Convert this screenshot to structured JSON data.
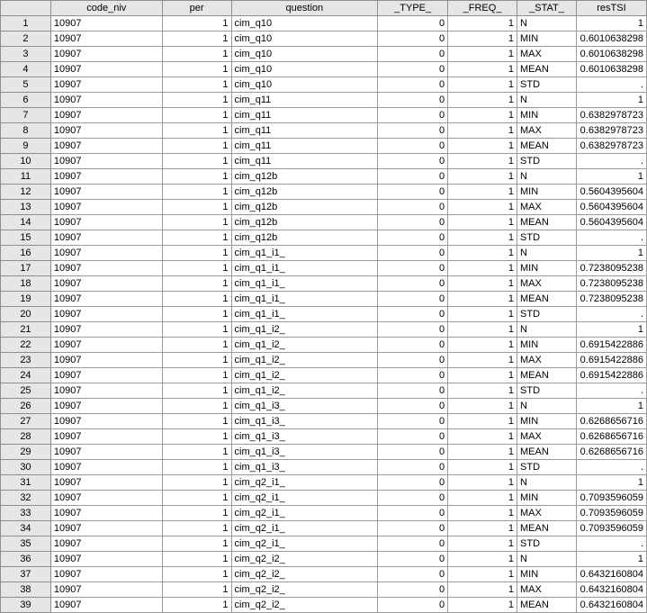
{
  "columns": [
    "code_niv",
    "per",
    "question",
    "_TYPE_",
    "_FREQ_",
    "_STAT_",
    "resTSI"
  ],
  "rows": [
    [
      "1",
      "10907",
      "1",
      "cim_q10",
      "0",
      "1",
      "N",
      "1"
    ],
    [
      "2",
      "10907",
      "1",
      "cim_q10",
      "0",
      "1",
      "MIN",
      "0.6010638298"
    ],
    [
      "3",
      "10907",
      "1",
      "cim_q10",
      "0",
      "1",
      "MAX",
      "0.6010638298"
    ],
    [
      "4",
      "10907",
      "1",
      "cim_q10",
      "0",
      "1",
      "MEAN",
      "0.6010638298"
    ],
    [
      "5",
      "10907",
      "1",
      "cim_q10",
      "0",
      "1",
      "STD",
      "."
    ],
    [
      "6",
      "10907",
      "1",
      "cim_q11",
      "0",
      "1",
      "N",
      "1"
    ],
    [
      "7",
      "10907",
      "1",
      "cim_q11",
      "0",
      "1",
      "MIN",
      "0.6382978723"
    ],
    [
      "8",
      "10907",
      "1",
      "cim_q11",
      "0",
      "1",
      "MAX",
      "0.6382978723"
    ],
    [
      "9",
      "10907",
      "1",
      "cim_q11",
      "0",
      "1",
      "MEAN",
      "0.6382978723"
    ],
    [
      "10",
      "10907",
      "1",
      "cim_q11",
      "0",
      "1",
      "STD",
      "."
    ],
    [
      "11",
      "10907",
      "1",
      "cim_q12b",
      "0",
      "1",
      "N",
      "1"
    ],
    [
      "12",
      "10907",
      "1",
      "cim_q12b",
      "0",
      "1",
      "MIN",
      "0.5604395604"
    ],
    [
      "13",
      "10907",
      "1",
      "cim_q12b",
      "0",
      "1",
      "MAX",
      "0.5604395604"
    ],
    [
      "14",
      "10907",
      "1",
      "cim_q12b",
      "0",
      "1",
      "MEAN",
      "0.5604395604"
    ],
    [
      "15",
      "10907",
      "1",
      "cim_q12b",
      "0",
      "1",
      "STD",
      "."
    ],
    [
      "16",
      "10907",
      "1",
      "cim_q1_i1_",
      "0",
      "1",
      "N",
      "1"
    ],
    [
      "17",
      "10907",
      "1",
      "cim_q1_i1_",
      "0",
      "1",
      "MIN",
      "0.7238095238"
    ],
    [
      "18",
      "10907",
      "1",
      "cim_q1_i1_",
      "0",
      "1",
      "MAX",
      "0.7238095238"
    ],
    [
      "19",
      "10907",
      "1",
      "cim_q1_i1_",
      "0",
      "1",
      "MEAN",
      "0.7238095238"
    ],
    [
      "20",
      "10907",
      "1",
      "cim_q1_i1_",
      "0",
      "1",
      "STD",
      "."
    ],
    [
      "21",
      "10907",
      "1",
      "cim_q1_i2_",
      "0",
      "1",
      "N",
      "1"
    ],
    [
      "22",
      "10907",
      "1",
      "cim_q1_i2_",
      "0",
      "1",
      "MIN",
      "0.6915422886"
    ],
    [
      "23",
      "10907",
      "1",
      "cim_q1_i2_",
      "0",
      "1",
      "MAX",
      "0.6915422886"
    ],
    [
      "24",
      "10907",
      "1",
      "cim_q1_i2_",
      "0",
      "1",
      "MEAN",
      "0.6915422886"
    ],
    [
      "25",
      "10907",
      "1",
      "cim_q1_i2_",
      "0",
      "1",
      "STD",
      "."
    ],
    [
      "26",
      "10907",
      "1",
      "cim_q1_i3_",
      "0",
      "1",
      "N",
      "1"
    ],
    [
      "27",
      "10907",
      "1",
      "cim_q1_i3_",
      "0",
      "1",
      "MIN",
      "0.6268656716"
    ],
    [
      "28",
      "10907",
      "1",
      "cim_q1_i3_",
      "0",
      "1",
      "MAX",
      "0.6268656716"
    ],
    [
      "29",
      "10907",
      "1",
      "cim_q1_i3_",
      "0",
      "1",
      "MEAN",
      "0.6268656716"
    ],
    [
      "30",
      "10907",
      "1",
      "cim_q1_i3_",
      "0",
      "1",
      "STD",
      "."
    ],
    [
      "31",
      "10907",
      "1",
      "cim_q2_i1_",
      "0",
      "1",
      "N",
      "1"
    ],
    [
      "32",
      "10907",
      "1",
      "cim_q2_i1_",
      "0",
      "1",
      "MIN",
      "0.7093596059"
    ],
    [
      "33",
      "10907",
      "1",
      "cim_q2_i1_",
      "0",
      "1",
      "MAX",
      "0.7093596059"
    ],
    [
      "34",
      "10907",
      "1",
      "cim_q2_i1_",
      "0",
      "1",
      "MEAN",
      "0.7093596059"
    ],
    [
      "35",
      "10907",
      "1",
      "cim_q2_i1_",
      "0",
      "1",
      "STD",
      "."
    ],
    [
      "36",
      "10907",
      "1",
      "cim_q2_i2_",
      "0",
      "1",
      "N",
      "1"
    ],
    [
      "37",
      "10907",
      "1",
      "cim_q2_i2_",
      "0",
      "1",
      "MIN",
      "0.6432160804"
    ],
    [
      "38",
      "10907",
      "1",
      "cim_q2_i2_",
      "0",
      "1",
      "MAX",
      "0.6432160804"
    ],
    [
      "39",
      "10907",
      "1",
      "cim_q2_i2_",
      "0",
      "1",
      "MEAN",
      "0.6432160804"
    ]
  ]
}
